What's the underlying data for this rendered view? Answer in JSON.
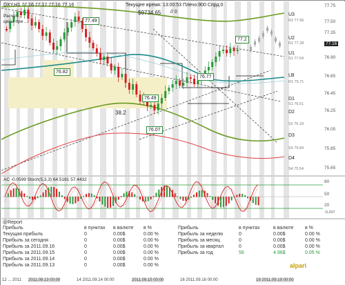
{
  "chart": {
    "symbol_line": "DXY,H1  77.16 77.17 77.16 77.16",
    "server_time": "Текущее время: 13:00:53 Плечо:900 Спрд:0",
    "balance": "$9734.65",
    "balance_suffix": "// 0",
    "annotation_line1": "Расчет...",
    "annotation_line2": "цены при ...",
    "fib_label": "38.2",
    "price_boxes": [
      "77.49",
      "77.2",
      "76.82",
      "76.77",
      "76.49",
      "76.07"
    ],
    "level_labels": [
      "U3",
      "U2",
      "U1",
      "LB",
      "D1",
      "D2",
      "D3",
      "D4"
    ],
    "level_sublabels": [
      "R2 77.56",
      "R1 77.28",
      "S1 77.04",
      "R1 76.71",
      "S1 76.51",
      "S2 76.18",
      "S3 75.84",
      "S4 75.54"
    ],
    "axis_prices": [
      "77.75",
      "77.50",
      "77.35",
      "77.16",
      "76.90",
      "76.65",
      "76.45",
      "76.25",
      "76.05",
      "75.85",
      "75.65"
    ],
    "current_price": "77.16"
  },
  "indicator": {
    "title": "AC -0.0599  Stoch(5,3,3) 64.5161 57.4432",
    "axis": [
      "80",
      "50",
      "20",
      "0.207",
      "-0.207"
    ]
  },
  "report": {
    "title": "@Report",
    "headers_left": [
      "Прибыль",
      "в пунктах",
      "в валюте",
      "в %"
    ],
    "headers_right": [
      "Прибыль",
      "в пунктах",
      "в валюте",
      "в %"
    ],
    "rows_left": [
      [
        "Текущая прибыль",
        "0",
        "0.00$",
        "0.00 %"
      ],
      [
        "Прибыль за сегодня",
        "0",
        "0.00$",
        "0.00 %"
      ],
      [
        "Прибыль за 2011.09.16",
        "0",
        "0.00$",
        "0.00 %"
      ],
      [
        "Прибыль за 2011.09.15",
        "0",
        "0.00$",
        "0.00 %"
      ],
      [
        "Прибыль за 2011.09.14",
        "0",
        "0.00$",
        "0.00 %"
      ],
      [
        "Прибыль за 2011.09.13",
        "0",
        "0.00$",
        "0.00 %"
      ]
    ],
    "rows_right": [
      [
        "Прибыль за неделю",
        "0",
        "0.00$",
        "0.00 %"
      ],
      [
        "Прибыль за месяц",
        "0",
        "0.00$",
        "0.00 %"
      ],
      [
        "Прибыль за квартал",
        "0",
        "0.00$",
        "0.00 %"
      ],
      [
        "Прибыль за год",
        "56",
        "4.96$",
        "0.05 %"
      ]
    ],
    "brand": "alpari"
  },
  "timebar": [
    "12 ... 2011",
    "2011.09.13 00:00",
    "14 2011.09.14 00:00",
    "2011.09.15 00:00",
    "16 2011.09.16 00:00",
    "19 2011.09.19 00:00"
  ],
  "colors": {
    "bull": "#2a9a3a",
    "bear": "#d32020",
    "teal": "#1a8a8a",
    "olive": "#6a9a20",
    "red_ma": "#e04040",
    "highlight": "#f5efc8"
  }
}
